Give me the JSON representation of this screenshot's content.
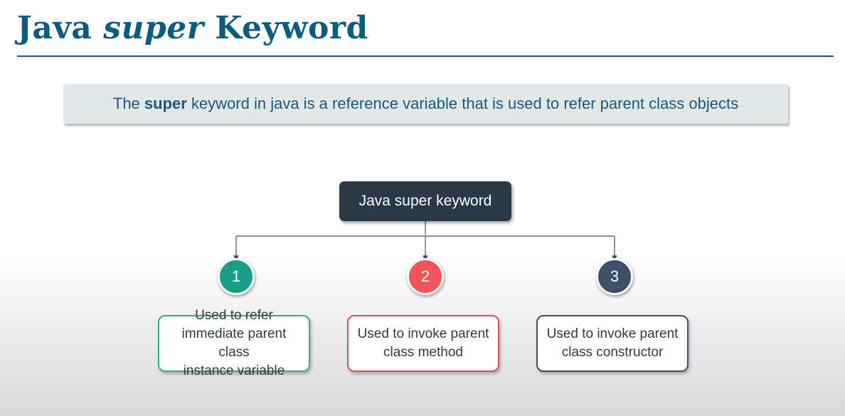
{
  "title": {
    "pre": "Java ",
    "italic": "super",
    "post": " Keyword"
  },
  "intro": {
    "pre": "The ",
    "bold": "super",
    "post": " keyword in java is a reference variable that is used to refer parent class objects"
  },
  "root": {
    "label": "Java super keyword"
  },
  "items": [
    {
      "number": "1",
      "color": "#1a9e8a",
      "border": "#3aa99a",
      "text": "Used to refer\nimmediate parent class\ninstance variable"
    },
    {
      "number": "2",
      "color": "#f0555a",
      "border": "#d65257",
      "text": "Used to invoke parent\nclass method"
    },
    {
      "number": "3",
      "color": "#3e5068",
      "border": "#3e5068",
      "text": "Used to invoke parent\nclass constructor"
    }
  ],
  "colors": {
    "title": "#0e5b82",
    "connector": "#44515c",
    "root_bg": "#2b3845"
  }
}
